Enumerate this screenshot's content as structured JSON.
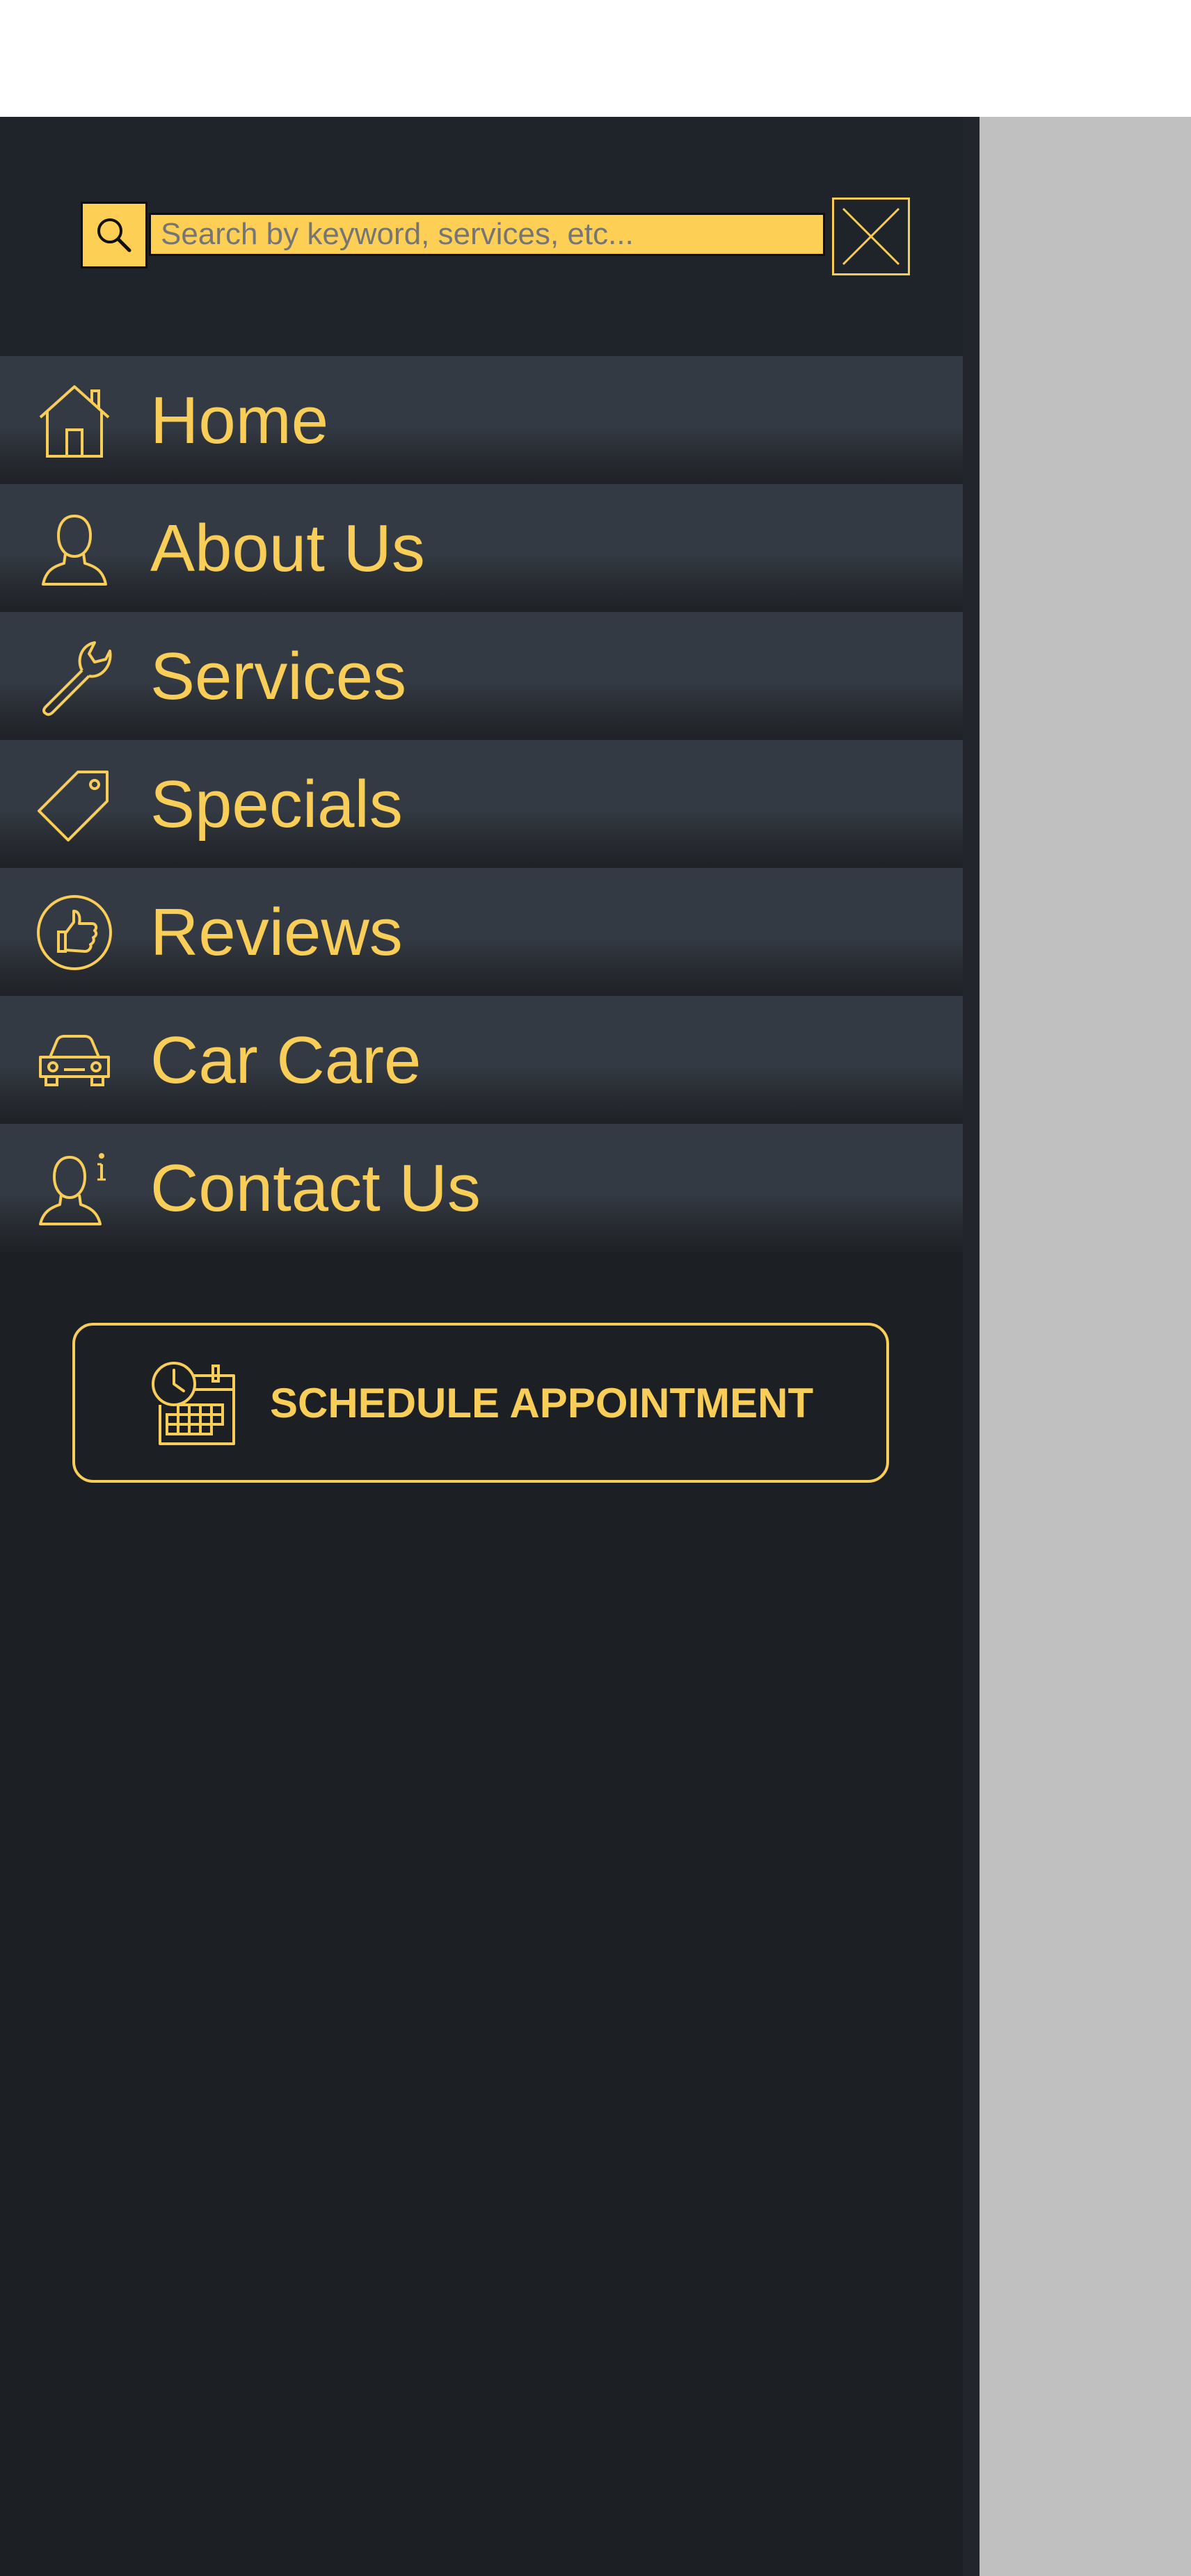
{
  "search": {
    "placeholder": "Search by keyword, services, etc...",
    "icon": "search-icon"
  },
  "close": {
    "icon": "close-icon"
  },
  "nav": {
    "items": [
      {
        "label": "Home",
        "icon": "home-icon"
      },
      {
        "label": "About Us",
        "icon": "person-icon"
      },
      {
        "label": "Services",
        "icon": "wrench-icon"
      },
      {
        "label": "Specials",
        "icon": "tag-icon"
      },
      {
        "label": "Reviews",
        "icon": "thumbs-up-icon"
      },
      {
        "label": "Car Care",
        "icon": "car-icon"
      },
      {
        "label": "Contact Us",
        "icon": "person-info-icon"
      }
    ]
  },
  "schedule": {
    "label": "SCHEDULE APPOINTMENT",
    "icon": "calendar-clock-icon"
  },
  "colors": {
    "accent": "#f8cd58",
    "search_bg": "#fecf55",
    "drawer_bg": "#1c1f23",
    "nav_item_bg": "#343a43",
    "overlay": "#c0c0c0"
  }
}
